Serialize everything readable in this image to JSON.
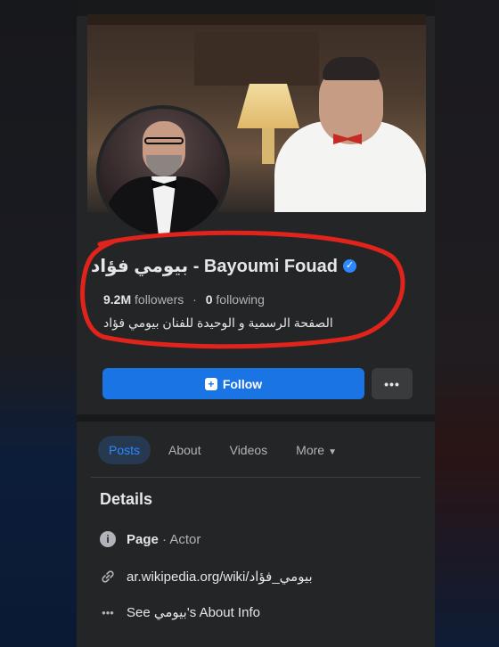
{
  "profile": {
    "name": "بيومي فؤاد - Bayoumi Fouad",
    "followers_count": "9.2M",
    "followers_label": "followers",
    "separator": "·",
    "following_count": "0",
    "following_label": "following",
    "bio": "الصفحة الرسمية و الوحيدة للفنان بيومي فؤاد"
  },
  "actions": {
    "follow_label": "Follow",
    "more_label": "•••"
  },
  "tabs": [
    {
      "label": "Posts",
      "active": true
    },
    {
      "label": "About",
      "active": false
    },
    {
      "label": "Videos",
      "active": false
    },
    {
      "label": "More",
      "active": false
    }
  ],
  "details": {
    "title": "Details",
    "category_label": "Page",
    "category_value": "· Actor",
    "link": "ar.wikipedia.org/wiki/بيومي_فؤاد",
    "about_info": "See بيومي's About Info"
  },
  "colors": {
    "accent": "#1b74e4",
    "verified": "#2d88ff",
    "annotation_ring": "#e0241b"
  },
  "icons": {
    "verified": "verified-badge-icon",
    "follow": "follow-plus-icon",
    "info": "info-icon",
    "link": "link-icon",
    "dots": "more-dots-icon",
    "caret": "caret-down-icon"
  }
}
